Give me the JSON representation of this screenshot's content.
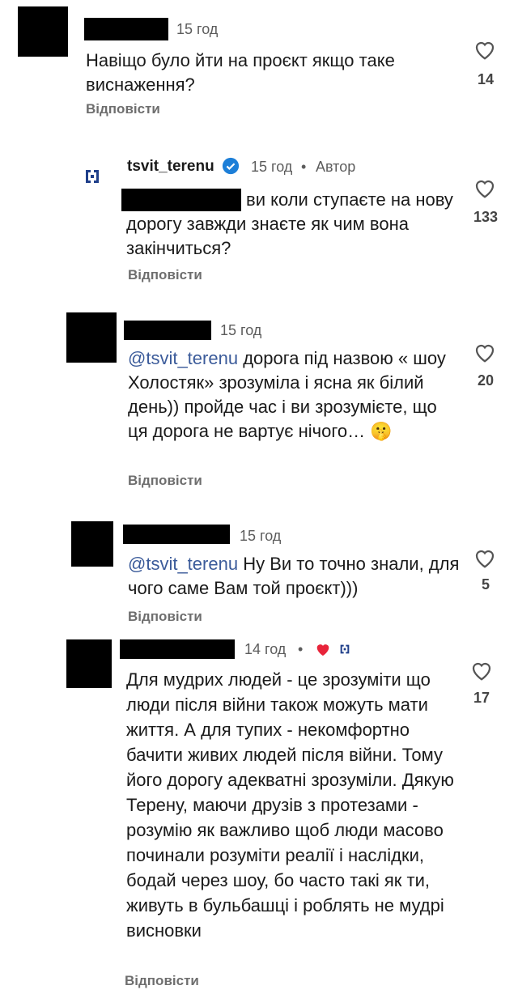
{
  "comments": [
    {
      "time": "15 год",
      "text": "Навіщо було йти на проєкт якщо таке виснаження?",
      "reply_label": "Відповісти",
      "likes": "14"
    },
    {
      "username": "tsvit_terenu",
      "time": "15 год",
      "author_badge": "Автор",
      "text": "ви коли ступаєте на нову дорогу завжди знаєте як чим вона закінчиться?",
      "reply_label": "Відповісти",
      "likes": "133"
    },
    {
      "time": "15 год",
      "mention": "@tsvit_terenu",
      "text": "дорога під назвою « шоу  Холостяк» зрозуміла і ясна як білий день)) пройде час і ви зрозумієте, що ця дорога не вартує нічого… 🤫",
      "reply_label": "Відповісти",
      "likes": "20"
    },
    {
      "time": "15 год",
      "mention": "@tsvit_terenu",
      "text": "Ну Ви то точно знали, для чого саме Вам той проєкт)))",
      "reply_label": "Відповісти",
      "likes": "5"
    },
    {
      "time": "14 год",
      "text": "Для мудрих людей - це зрозуміти що люди після війни також можуть мати життя. А для тупих - некомфортно бачити живих людей після війни. Тому його дорогу адекватні зрозуміли. Дякую Терену, маючи друзів з протезами - розумію як важливо щоб люди масово починали розуміти реалії і наслідки, бодай через шоу, бо часто такі як ти, живуть в бульбашці і роблять не мудрі висновки",
      "reply_label": "Відповісти",
      "likes": "17"
    }
  ],
  "colors": {
    "verified": "#1d7fd8",
    "heart_liked": "#e8243a"
  }
}
